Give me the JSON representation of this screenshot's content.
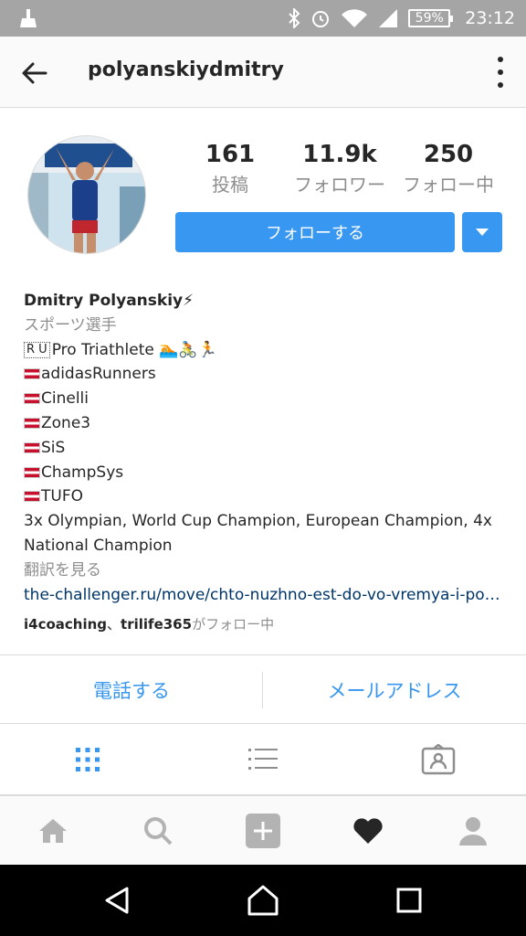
{
  "status_bar": {
    "battery": "59%",
    "time": "23:12"
  },
  "header": {
    "username": "polyanskiydmitry"
  },
  "stats": {
    "posts_count": "161",
    "posts_label": "投稿",
    "followers_count": "11.9k",
    "followers_label": "フォロワー",
    "following_count": "250",
    "following_label": "フォロー中"
  },
  "actions": {
    "follow_label": "フォローする"
  },
  "bio": {
    "name": "Dmitry Polyanskiy⚡",
    "category": "スポーツ選手",
    "line_ru": "Pro Triathlete 🏊🚴🏃",
    "ru_code": "R U",
    "sponsors": [
      "adidasRunners",
      "Cinelli",
      "Zone3",
      "SiS",
      "ChampSys",
      "TUFO"
    ],
    "description": "3x Olympian, World Cup Champion, European Champion, 4x National Champion",
    "translate": "翻訳を見る",
    "link": "the-challenger.ru/move/chto-nuzhno-est-do-vo-vremya-i-po…",
    "followed_by_user1": "i4coaching",
    "followed_by_sep": "、",
    "followed_by_user2": "trilife365",
    "followed_by_suffix": "がフォロー中"
  },
  "contact": {
    "call_label": "電話する",
    "email_label": "メールアドレス"
  },
  "colors": {
    "accent": "#3897f0",
    "status_bar": "#a5a5a5",
    "link": "#003569"
  },
  "icons": {
    "back": "arrow-left-icon",
    "more": "more-vertical-icon",
    "grid": "grid-icon",
    "list": "list-icon",
    "tagged": "tagged-icon",
    "home": "home-icon",
    "search": "search-icon",
    "add": "add-icon",
    "activity": "heart-icon",
    "profile": "profile-icon"
  }
}
